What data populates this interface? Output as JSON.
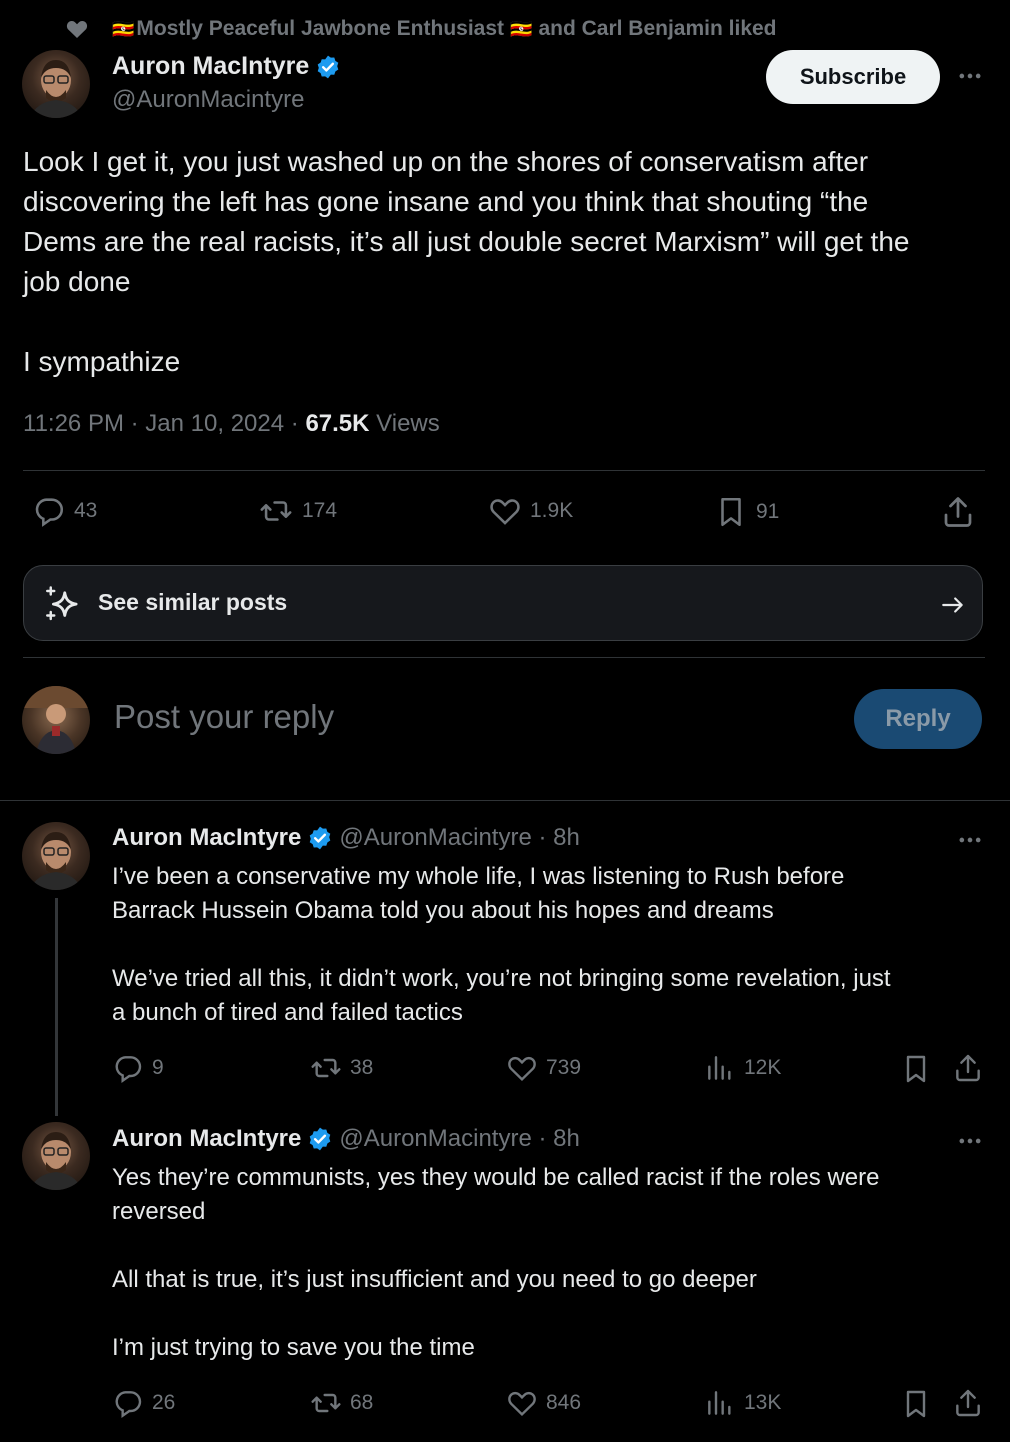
{
  "social_context": {
    "flag_left": "🇺🇬",
    "name1": "Mostly Peaceful Jawbone Enthusiast",
    "flag_right": "🇺🇬",
    "rest": "and Carl Benjamin liked"
  },
  "main_post": {
    "author_name": "Auron MacIntyre",
    "author_handle": "@AuronMacintyre",
    "subscribe_label": "Subscribe",
    "text_lines": [
      "Look I get it, you just washed up on the shores of conservatism after",
      "discovering the left has gone insane and you think that shouting “the",
      "Dems are the real racists, it’s all just double secret Marxism” will get the",
      "job done"
    ],
    "text_line2": "I sympathize",
    "time": "11:26 PM",
    "date": "Jan 10, 2024",
    "views_count": "67.5K",
    "views_label": "Views",
    "stats": {
      "replies": "43",
      "reposts": "174",
      "likes": "1.9K",
      "bookmarks": "91"
    }
  },
  "similar": {
    "label": "See similar posts"
  },
  "composer": {
    "placeholder": "Post your reply",
    "reply_label": "Reply"
  },
  "replies": [
    {
      "author_name": "Auron MacIntyre",
      "author_handle": "@AuronMacintyre",
      "time": "8h",
      "para1": [
        "I’ve been a conservative my whole life, I was listening to Rush before",
        "Barrack Hussein Obama told you about his hopes and dreams"
      ],
      "para2": [
        "We’ve tried all this, it didn’t work, you’re not bringing some revelation, just",
        "a bunch of tired and failed tactics"
      ],
      "para3": [],
      "replies": "9",
      "reposts": "38",
      "likes": "739",
      "views": "12K"
    },
    {
      "author_name": "Auron MacIntyre",
      "author_handle": "@AuronMacintyre",
      "time": "8h",
      "para1": [
        "Yes they’re communists, yes they would be called racist if the roles were",
        "reversed"
      ],
      "para2": [
        "All that is true, it’s just insufficient and you need to go deeper"
      ],
      "para3": [
        "I’m just trying to save you the time"
      ],
      "replies": "26",
      "reposts": "68",
      "likes": "846",
      "views": "13K"
    }
  ],
  "colors": {
    "background": "#000000",
    "text": "#e7e9ea",
    "muted": "#71767b",
    "verified": "#1d9bf0",
    "reply_button": "#1a4a73",
    "divider": "#2f3336"
  }
}
